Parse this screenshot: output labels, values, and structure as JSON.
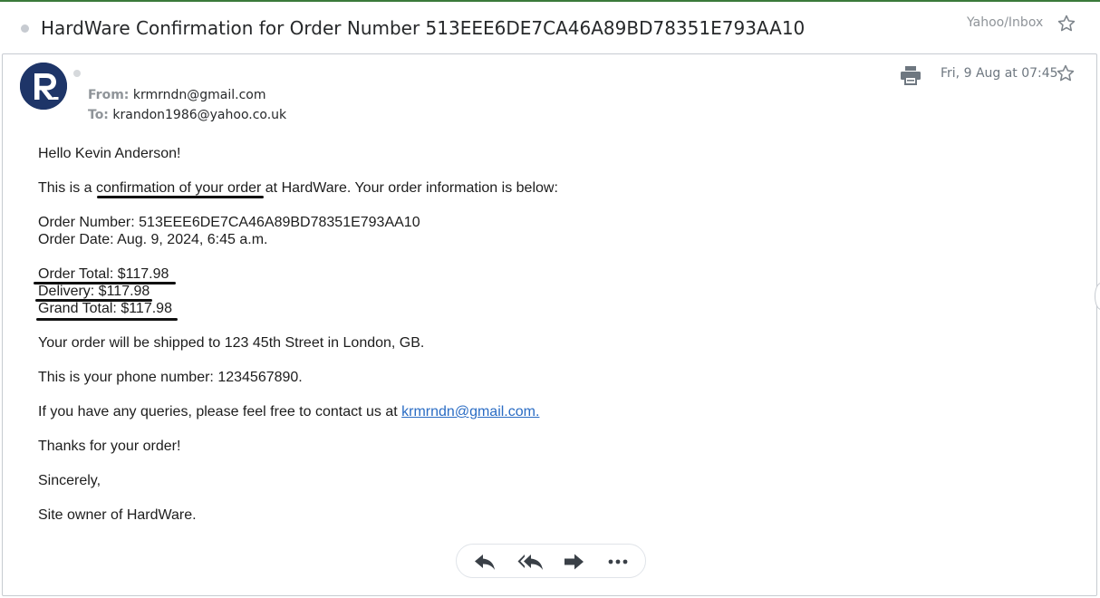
{
  "subject": "HardWare Confirmation for Order Number 513EEE6DE7CA46A89BD78351E793AA10",
  "folder": "Yahoo/Inbox",
  "icons": {
    "star": "star-icon",
    "print": "print-icon",
    "reply": "reply-icon",
    "reply_all": "reply-all-icon",
    "forward": "forward-icon",
    "more": "more-icon",
    "avatar_letter": "R"
  },
  "colors": {
    "avatar_bg": "#1e3568",
    "link": "#2a6cc4",
    "accent_top": "#3a7a3a"
  },
  "message": {
    "from_label": "From:",
    "from": "krmrndn@gmail.com",
    "to_label": "To:",
    "to": "krandon1986@yahoo.co.uk",
    "date": "Fri, 9 Aug at 07:45",
    "greeting": "Hello Kevin Anderson!",
    "intro_pre": "This is a ",
    "intro_link": "confirmation of your order",
    "intro_post": " at HardWare. Your order information is below:",
    "order_number": "Order Number: 513EEE6DE7CA46A89BD78351E793AA10",
    "order_date": "Order Date: Aug. 9, 2024, 6:45 a.m.",
    "order_total": "Order Total: $117.98",
    "delivery": "Delivery: $117.98",
    "grand_total": "Grand Total: $117.98",
    "shipping": "Your order will be shipped to 123 45th Street in London, GB.",
    "phone": "This is your phone number: 1234567890.",
    "queries_pre": "If you have any queries, please feel free to contact us at ",
    "queries_link": "krmrndn@gmail.com.",
    "thanks": "Thanks for your order!",
    "sincerely": "Sincerely,",
    "signature": "Site owner of HardWare."
  }
}
